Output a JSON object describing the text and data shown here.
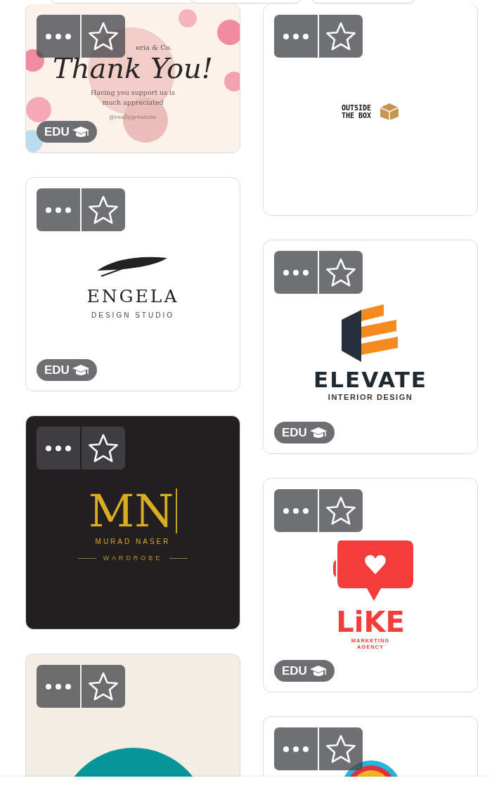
{
  "columns": [
    {
      "templates": [
        {
          "kind": "thank_you",
          "favorite": false,
          "badge": "EDU",
          "texts": [
            "eria & Co.",
            "Thank You!",
            "Having you support us is much appreciated",
            "@reallygreatsite"
          ]
        },
        {
          "kind": "engela",
          "favorite": false,
          "badge": "EDU",
          "texts": [
            "ENGELA",
            "DESIGN STUDIO"
          ]
        },
        {
          "kind": "monogram",
          "favorite": false,
          "texts": [
            "MN",
            "MURAD NASER",
            "WARDROBE"
          ]
        },
        {
          "kind": "teal_circle",
          "favorite": false
        }
      ]
    },
    {
      "templates": [
        {
          "kind": "outside_box",
          "favorite": false,
          "texts": [
            "OUTSIDE THE BOX"
          ]
        },
        {
          "kind": "elevate",
          "favorite": false,
          "badge": "EDU",
          "texts": [
            "ELEVATE",
            "INTERIOR DESIGN"
          ]
        },
        {
          "kind": "like",
          "favorite": false,
          "badge": "EDU",
          "texts": [
            "LiKE",
            "MARKETING AGENCY"
          ]
        },
        {
          "kind": "rainbow",
          "favorite": false
        }
      ]
    }
  ]
}
